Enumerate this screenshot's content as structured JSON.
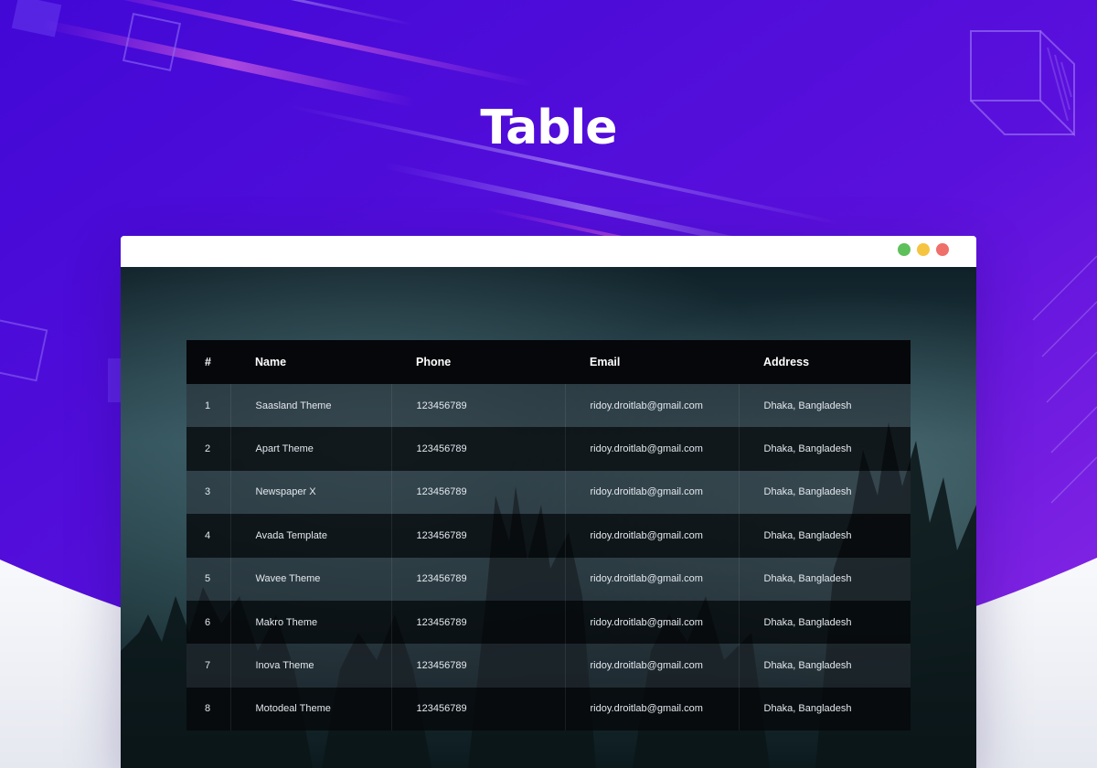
{
  "page": {
    "title": "Table"
  },
  "colors": {
    "hero_start": "#4a0bd9",
    "hero_end": "#8a27e6",
    "table_header": "#05070a",
    "dot_green": "#5ec05a",
    "dot_yellow": "#f5c542",
    "dot_red": "#ef6f6a"
  },
  "browser": {
    "controls": [
      "minimize",
      "maximize",
      "close"
    ]
  },
  "table": {
    "headers": [
      "#",
      "Name",
      "Phone",
      "Email",
      "Address"
    ],
    "rows": [
      [
        "1",
        "Saasland Theme",
        "123456789",
        "ridoy.droitlab@gmail.com",
        "Dhaka, Bangladesh"
      ],
      [
        "2",
        "Apart Theme",
        "123456789",
        "ridoy.droitlab@gmail.com",
        "Dhaka, Bangladesh"
      ],
      [
        "3",
        "Newspaper X",
        "123456789",
        "ridoy.droitlab@gmail.com",
        "Dhaka, Bangladesh"
      ],
      [
        "4",
        "Avada Template",
        "123456789",
        "ridoy.droitlab@gmail.com",
        "Dhaka, Bangladesh"
      ],
      [
        "5",
        "Wavee Theme",
        "123456789",
        "ridoy.droitlab@gmail.com",
        "Dhaka, Bangladesh"
      ],
      [
        "6",
        "Makro Theme",
        "123456789",
        "ridoy.droitlab@gmail.com",
        "Dhaka, Bangladesh"
      ],
      [
        "7",
        "Inova Theme",
        "123456789",
        "ridoy.droitlab@gmail.com",
        "Dhaka, Bangladesh"
      ],
      [
        "8",
        "Motodeal Theme",
        "123456789",
        "ridoy.droitlab@gmail.com",
        "Dhaka, Bangladesh"
      ]
    ]
  }
}
